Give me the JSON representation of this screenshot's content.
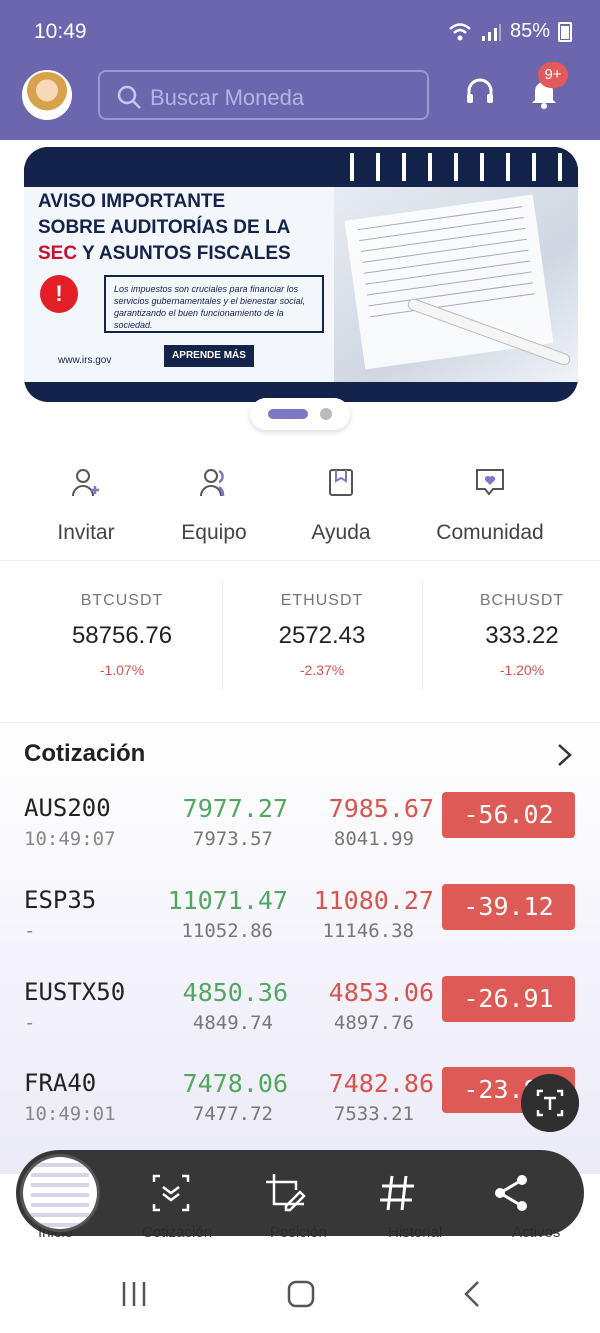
{
  "status_bar": {
    "time": "10:49",
    "battery": "85%"
  },
  "header": {
    "search_placeholder": "Buscar Moneda",
    "notification_badge": "9+"
  },
  "banner": {
    "title_line1": "AVISO IMPORTANTE",
    "title_line2": "SOBRE AUDITORÍAS DE LA",
    "title_highlight": "SEC",
    "title_line3_rest": " Y ASUNTOS FISCALES",
    "body": "Los impuestos son cruciales para financiar los servicios gubernamentales y el bienestar social, garantizando el buen funcionamiento de la sociedad.",
    "url": "www.irs.gov",
    "cta": "APRENDE MÁS",
    "alert_glyph": "!"
  },
  "shortcuts": [
    {
      "label": "Invitar",
      "icon": "person-add-icon"
    },
    {
      "label": "Equipo",
      "icon": "team-icon"
    },
    {
      "label": "Ayuda",
      "icon": "help-book-icon"
    },
    {
      "label": "Comunidad",
      "icon": "community-chat-icon"
    }
  ],
  "tickers": [
    {
      "symbol": "BTCUSDT",
      "price": "58756.76",
      "change": "-1.07%"
    },
    {
      "symbol": "ETHUSDT",
      "price": "2572.43",
      "change": "-2.37%"
    },
    {
      "symbol": "BCHUSDT",
      "price": "333.22",
      "change": "-1.20%"
    }
  ],
  "quotes": {
    "title": "Cotización",
    "rows": [
      {
        "symbol": "AUS200",
        "time": "10:49:07",
        "bid": "7977.27",
        "bid_low": "7973.57",
        "ask": "7985.67",
        "ask_high": "8041.99",
        "change": "-56.02"
      },
      {
        "symbol": "ESP35",
        "time": "-",
        "bid": "11071.47",
        "bid_low": "11052.86",
        "ask": "11080.27",
        "ask_high": "11146.38",
        "change": "-39.12"
      },
      {
        "symbol": "EUSTX50",
        "time": "-",
        "bid": "4850.36",
        "bid_low": "4849.74",
        "ask": "4853.06",
        "ask_high": "4897.76",
        "change": "-26.91"
      },
      {
        "symbol": "FRA40",
        "time": "10:49:01",
        "bid": "7478.06",
        "bid_low": "7477.72",
        "ask": "7482.86",
        "ask_high": "7533.21",
        "change": "-23.84"
      }
    ]
  },
  "bottom_nav": {
    "items": [
      "Inicio",
      "Cotización",
      "Posición",
      "Historial",
      "Activos"
    ]
  },
  "colors": {
    "header_bg": "#6b66ad",
    "positive": "#52a861",
    "negative": "#d9534f",
    "pill_negative": "#de5a57",
    "banner_navy": "#13234a"
  }
}
